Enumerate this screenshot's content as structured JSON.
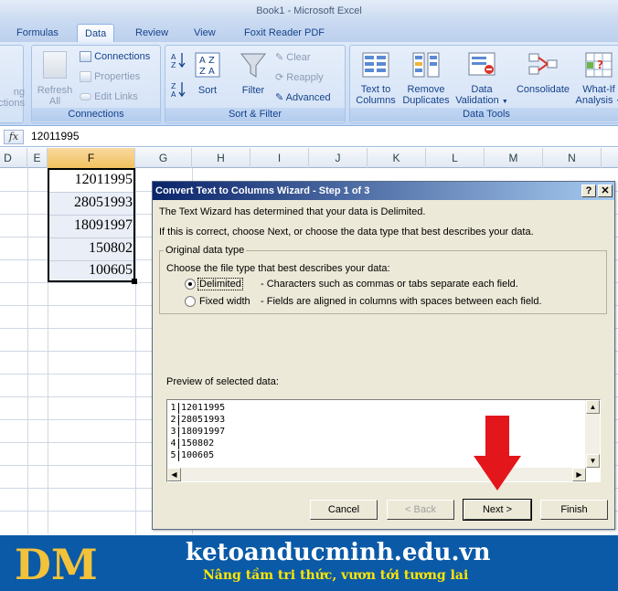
{
  "window": {
    "title": "Book1 - Microsoft Excel"
  },
  "ribbon": {
    "tabs": [
      "Formulas",
      "Data",
      "Review",
      "View",
      "Foxit Reader PDF"
    ],
    "active_tab": "Data",
    "connections_group": {
      "partial_left_label": [
        "ng",
        "ctions"
      ],
      "refresh_all": [
        "Refresh",
        "All"
      ],
      "connections": "Connections",
      "properties": "Properties",
      "edit_links": "Edit Links",
      "label": "Connections"
    },
    "sort_filter_group": {
      "sort": "Sort",
      "filter": "Filter",
      "clear": "Clear",
      "reapply": "Reapply",
      "advanced": "Advanced",
      "label": "Sort & Filter"
    },
    "data_tools_group": {
      "text_to_columns": [
        "Text to",
        "Columns"
      ],
      "remove_duplicates": [
        "Remove",
        "Duplicates"
      ],
      "data_validation": [
        "Data",
        "Validation"
      ],
      "consolidate": "Consolidate",
      "what_if": [
        "What-If",
        "Analysis"
      ],
      "label": "Data Tools"
    }
  },
  "formula_bar": {
    "fx": "fx",
    "value": "12011995"
  },
  "sheet": {
    "columns": [
      "D",
      "E",
      "F",
      "G",
      "H",
      "I",
      "J",
      "K",
      "L",
      "M",
      "N"
    ],
    "selected_column": "F",
    "cells": [
      "12011995",
      "28051993",
      "18091997",
      "150802",
      "100605"
    ]
  },
  "dialog": {
    "title": "Convert Text to Columns Wizard - Step 1 of 3",
    "help_btn": "?",
    "close_btn": "✕",
    "line1": "The Text Wizard has determined that your data is Delimited.",
    "line2": "If this is correct, choose Next, or choose the data type that best describes your data.",
    "group_title": "Original data type",
    "choose_label": "Choose the file type that best describes your data:",
    "options": [
      {
        "label": "Delimited",
        "desc": "- Characters such as commas or tabs separate each field.",
        "selected": true
      },
      {
        "label": "Fixed width",
        "desc": "- Fields are aligned in columns with spaces between each field.",
        "selected": false
      }
    ],
    "preview_label": "Preview of selected data:",
    "preview_rows": [
      {
        "n": "1",
        "v": "12011995"
      },
      {
        "n": "2",
        "v": "28051993"
      },
      {
        "n": "3",
        "v": "18091997"
      },
      {
        "n": "4",
        "v": "150802"
      },
      {
        "n": "5",
        "v": "100605"
      }
    ],
    "buttons": {
      "cancel": "Cancel",
      "back": "< Back",
      "next": "Next >",
      "finish": "Finish"
    }
  },
  "colors": {
    "arrow": "#e3161b",
    "banner_bg": "#0b5aa8",
    "banner_sub": "#ffe600"
  },
  "banner": {
    "logo_text": "DM",
    "site": "ketoanducminh.edu.vn",
    "slogan": "Nâng tầm tri thức, vươn tới tương lai"
  }
}
